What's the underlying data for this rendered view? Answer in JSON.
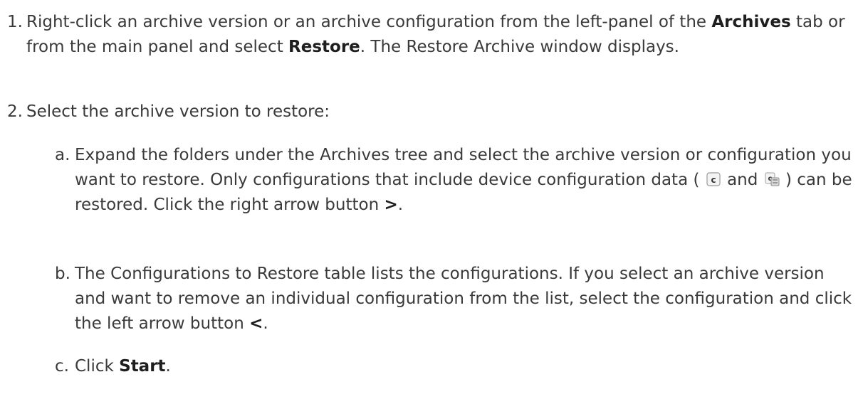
{
  "steps": [
    {
      "number": "1.",
      "text_1": "Right-click an archive version or an archive configuration from the left-panel of the ",
      "bold_archives": "Archives",
      "text_2": " tab or from the main panel and select ",
      "bold_restore": "Restore",
      "text_3": ". The Restore Archive window displays."
    },
    {
      "number": "2.",
      "text": "Select the archive version to restore:",
      "substeps": [
        {
          "letter": "a.",
          "text_1": "Expand the folders under the Archives tree and select the archive version or configuration you want to restore. Only configurations that include device configuration data ( ",
          "text_and": " and ",
          "text_2": " ) can be restored. Click the right arrow button ",
          "bold_arrow": ">",
          "text_3": ".",
          "icons": [
            "config-c-icon",
            "config-c-stack-icon"
          ]
        },
        {
          "letter": "b.",
          "text_1": "The Configurations to Restore table lists the configurations. If you select an archive version and want to remove an individual configuration from the list, select the configuration and click the left arrow button ",
          "bold_arrow": "<",
          "text_2": "."
        },
        {
          "letter": "c.",
          "text_1": "Click ",
          "bold_start": "Start",
          "text_2": "."
        }
      ]
    }
  ]
}
